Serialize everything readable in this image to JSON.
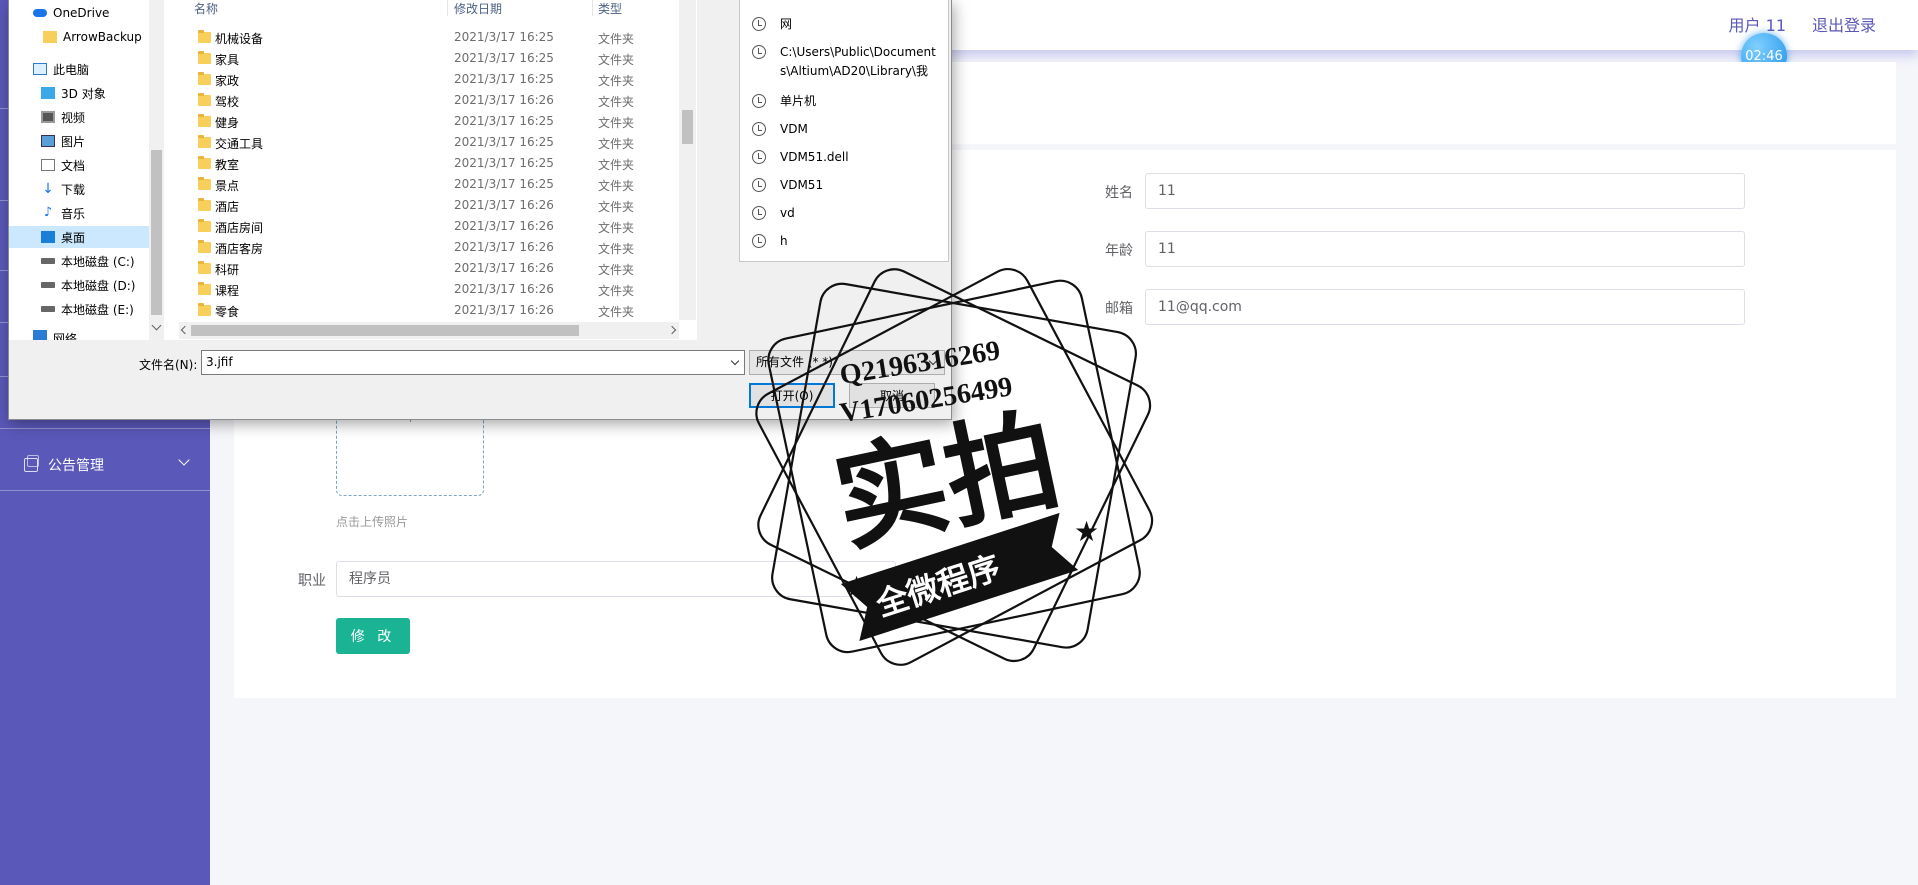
{
  "header": {
    "user_label": "用户 11",
    "logout_label": "退出登录",
    "timer": "02:46"
  },
  "sidebar": {
    "items": [
      {
        "label": "公告管理"
      }
    ]
  },
  "form": {
    "name_label": "姓名",
    "name_value": "11",
    "age_label": "年龄",
    "age_value": "11",
    "email_label": "邮箱",
    "email_value": "11@qq.com",
    "upload_hint": "点击上传照片",
    "job_label": "职业",
    "job_value": "程序员",
    "submit_label": "修 改"
  },
  "dialog": {
    "nav_items": [
      {
        "label": "OneDrive",
        "icon": "cloud-icon"
      },
      {
        "label": "ArrowBackup",
        "icon": "folder-icon"
      },
      {
        "label": "此电脑",
        "icon": "computer-icon"
      },
      {
        "label": "3D 对象",
        "icon": "cube-icon"
      },
      {
        "label": "视频",
        "icon": "video-icon"
      },
      {
        "label": "图片",
        "icon": "picture-icon"
      },
      {
        "label": "文档",
        "icon": "document-icon"
      },
      {
        "label": "下载",
        "icon": "download-icon"
      },
      {
        "label": "音乐",
        "icon": "music-icon"
      },
      {
        "label": "桌面",
        "icon": "desktop-icon"
      },
      {
        "label": "本地磁盘 (C:)",
        "icon": "drive-icon"
      },
      {
        "label": "本地磁盘 (D:)",
        "icon": "drive-icon"
      },
      {
        "label": "本地磁盘 (E:)",
        "icon": "drive-icon"
      },
      {
        "label": "网络",
        "icon": "network-icon"
      }
    ],
    "columns": {
      "name": "名称",
      "date": "修改日期",
      "type": "类型"
    },
    "files": [
      {
        "name": "机械设备",
        "date": "2021/3/17 16:25",
        "type": "文件夹"
      },
      {
        "name": "家具",
        "date": "2021/3/17 16:25",
        "type": "文件夹"
      },
      {
        "name": "家政",
        "date": "2021/3/17 16:25",
        "type": "文件夹"
      },
      {
        "name": "驾校",
        "date": "2021/3/17 16:26",
        "type": "文件夹"
      },
      {
        "name": "健身",
        "date": "2021/3/17 16:25",
        "type": "文件夹"
      },
      {
        "name": "交通工具",
        "date": "2021/3/17 16:25",
        "type": "文件夹"
      },
      {
        "name": "教室",
        "date": "2021/3/17 16:25",
        "type": "文件夹"
      },
      {
        "name": "景点",
        "date": "2021/3/17 16:25",
        "type": "文件夹"
      },
      {
        "name": "酒店",
        "date": "2021/3/17 16:26",
        "type": "文件夹"
      },
      {
        "name": "酒店房间",
        "date": "2021/3/17 16:26",
        "type": "文件夹"
      },
      {
        "name": "酒店客房",
        "date": "2021/3/17 16:26",
        "type": "文件夹"
      },
      {
        "name": "科研",
        "date": "2021/3/17 16:26",
        "type": "文件夹"
      },
      {
        "name": "课程",
        "date": "2021/3/17 16:26",
        "type": "文件夹"
      },
      {
        "name": "零食",
        "date": "2021/3/17 16:26",
        "type": "文件夹"
      }
    ],
    "recent_items": [
      "网",
      "C:\\Users\\Public\\Documents\\Altium\\AD20\\Library\\我",
      "单片机",
      "VDM",
      "VDM51.dell",
      "VDM51",
      "vd",
      "h"
    ],
    "filename_label": "文件名(N):",
    "filename_value": "3.jfif",
    "filetype_value": "所有文件 (*.*)",
    "open_label": "打开(O)",
    "cancel_label": "取消"
  },
  "watermark": {
    "line1": "Q2196316269",
    "line2": "V17060256499",
    "big_text": "实拍",
    "ribbon_text": "全微程序"
  }
}
